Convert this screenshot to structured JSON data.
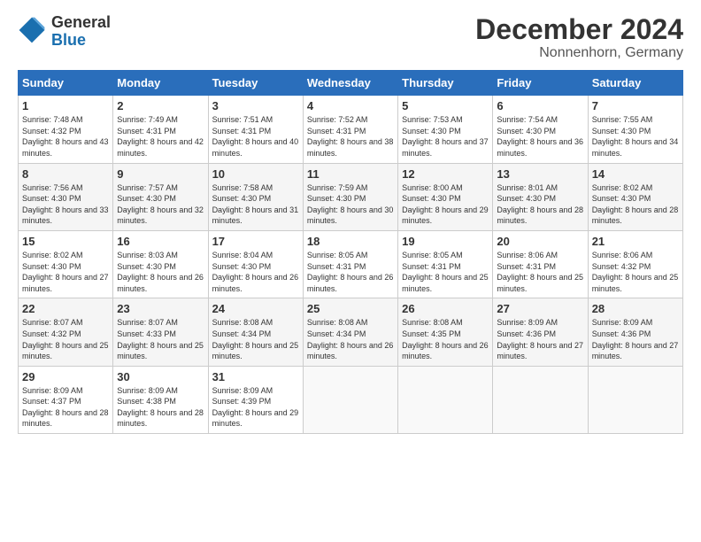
{
  "header": {
    "logo_general": "General",
    "logo_blue": "Blue",
    "title": "December 2024",
    "subtitle": "Nonnenhorn, Germany"
  },
  "columns": [
    "Sunday",
    "Monday",
    "Tuesday",
    "Wednesday",
    "Thursday",
    "Friday",
    "Saturday"
  ],
  "weeks": [
    [
      {
        "day": "1",
        "sunrise": "Sunrise: 7:48 AM",
        "sunset": "Sunset: 4:32 PM",
        "daylight": "Daylight: 8 hours and 43 minutes."
      },
      {
        "day": "2",
        "sunrise": "Sunrise: 7:49 AM",
        "sunset": "Sunset: 4:31 PM",
        "daylight": "Daylight: 8 hours and 42 minutes."
      },
      {
        "day": "3",
        "sunrise": "Sunrise: 7:51 AM",
        "sunset": "Sunset: 4:31 PM",
        "daylight": "Daylight: 8 hours and 40 minutes."
      },
      {
        "day": "4",
        "sunrise": "Sunrise: 7:52 AM",
        "sunset": "Sunset: 4:31 PM",
        "daylight": "Daylight: 8 hours and 38 minutes."
      },
      {
        "day": "5",
        "sunrise": "Sunrise: 7:53 AM",
        "sunset": "Sunset: 4:30 PM",
        "daylight": "Daylight: 8 hours and 37 minutes."
      },
      {
        "day": "6",
        "sunrise": "Sunrise: 7:54 AM",
        "sunset": "Sunset: 4:30 PM",
        "daylight": "Daylight: 8 hours and 36 minutes."
      },
      {
        "day": "7",
        "sunrise": "Sunrise: 7:55 AM",
        "sunset": "Sunset: 4:30 PM",
        "daylight": "Daylight: 8 hours and 34 minutes."
      }
    ],
    [
      {
        "day": "8",
        "sunrise": "Sunrise: 7:56 AM",
        "sunset": "Sunset: 4:30 PM",
        "daylight": "Daylight: 8 hours and 33 minutes."
      },
      {
        "day": "9",
        "sunrise": "Sunrise: 7:57 AM",
        "sunset": "Sunset: 4:30 PM",
        "daylight": "Daylight: 8 hours and 32 minutes."
      },
      {
        "day": "10",
        "sunrise": "Sunrise: 7:58 AM",
        "sunset": "Sunset: 4:30 PM",
        "daylight": "Daylight: 8 hours and 31 minutes."
      },
      {
        "day": "11",
        "sunrise": "Sunrise: 7:59 AM",
        "sunset": "Sunset: 4:30 PM",
        "daylight": "Daylight: 8 hours and 30 minutes."
      },
      {
        "day": "12",
        "sunrise": "Sunrise: 8:00 AM",
        "sunset": "Sunset: 4:30 PM",
        "daylight": "Daylight: 8 hours and 29 minutes."
      },
      {
        "day": "13",
        "sunrise": "Sunrise: 8:01 AM",
        "sunset": "Sunset: 4:30 PM",
        "daylight": "Daylight: 8 hours and 28 minutes."
      },
      {
        "day": "14",
        "sunrise": "Sunrise: 8:02 AM",
        "sunset": "Sunset: 4:30 PM",
        "daylight": "Daylight: 8 hours and 28 minutes."
      }
    ],
    [
      {
        "day": "15",
        "sunrise": "Sunrise: 8:02 AM",
        "sunset": "Sunset: 4:30 PM",
        "daylight": "Daylight: 8 hours and 27 minutes."
      },
      {
        "day": "16",
        "sunrise": "Sunrise: 8:03 AM",
        "sunset": "Sunset: 4:30 PM",
        "daylight": "Daylight: 8 hours and 26 minutes."
      },
      {
        "day": "17",
        "sunrise": "Sunrise: 8:04 AM",
        "sunset": "Sunset: 4:30 PM",
        "daylight": "Daylight: 8 hours and 26 minutes."
      },
      {
        "day": "18",
        "sunrise": "Sunrise: 8:05 AM",
        "sunset": "Sunset: 4:31 PM",
        "daylight": "Daylight: 8 hours and 26 minutes."
      },
      {
        "day": "19",
        "sunrise": "Sunrise: 8:05 AM",
        "sunset": "Sunset: 4:31 PM",
        "daylight": "Daylight: 8 hours and 25 minutes."
      },
      {
        "day": "20",
        "sunrise": "Sunrise: 8:06 AM",
        "sunset": "Sunset: 4:31 PM",
        "daylight": "Daylight: 8 hours and 25 minutes."
      },
      {
        "day": "21",
        "sunrise": "Sunrise: 8:06 AM",
        "sunset": "Sunset: 4:32 PM",
        "daylight": "Daylight: 8 hours and 25 minutes."
      }
    ],
    [
      {
        "day": "22",
        "sunrise": "Sunrise: 8:07 AM",
        "sunset": "Sunset: 4:32 PM",
        "daylight": "Daylight: 8 hours and 25 minutes."
      },
      {
        "day": "23",
        "sunrise": "Sunrise: 8:07 AM",
        "sunset": "Sunset: 4:33 PM",
        "daylight": "Daylight: 8 hours and 25 minutes."
      },
      {
        "day": "24",
        "sunrise": "Sunrise: 8:08 AM",
        "sunset": "Sunset: 4:34 PM",
        "daylight": "Daylight: 8 hours and 25 minutes."
      },
      {
        "day": "25",
        "sunrise": "Sunrise: 8:08 AM",
        "sunset": "Sunset: 4:34 PM",
        "daylight": "Daylight: 8 hours and 26 minutes."
      },
      {
        "day": "26",
        "sunrise": "Sunrise: 8:08 AM",
        "sunset": "Sunset: 4:35 PM",
        "daylight": "Daylight: 8 hours and 26 minutes."
      },
      {
        "day": "27",
        "sunrise": "Sunrise: 8:09 AM",
        "sunset": "Sunset: 4:36 PM",
        "daylight": "Daylight: 8 hours and 27 minutes."
      },
      {
        "day": "28",
        "sunrise": "Sunrise: 8:09 AM",
        "sunset": "Sunset: 4:36 PM",
        "daylight": "Daylight: 8 hours and 27 minutes."
      }
    ],
    [
      {
        "day": "29",
        "sunrise": "Sunrise: 8:09 AM",
        "sunset": "Sunset: 4:37 PM",
        "daylight": "Daylight: 8 hours and 28 minutes."
      },
      {
        "day": "30",
        "sunrise": "Sunrise: 8:09 AM",
        "sunset": "Sunset: 4:38 PM",
        "daylight": "Daylight: 8 hours and 28 minutes."
      },
      {
        "day": "31",
        "sunrise": "Sunrise: 8:09 AM",
        "sunset": "Sunset: 4:39 PM",
        "daylight": "Daylight: 8 hours and 29 minutes."
      },
      null,
      null,
      null,
      null
    ]
  ]
}
